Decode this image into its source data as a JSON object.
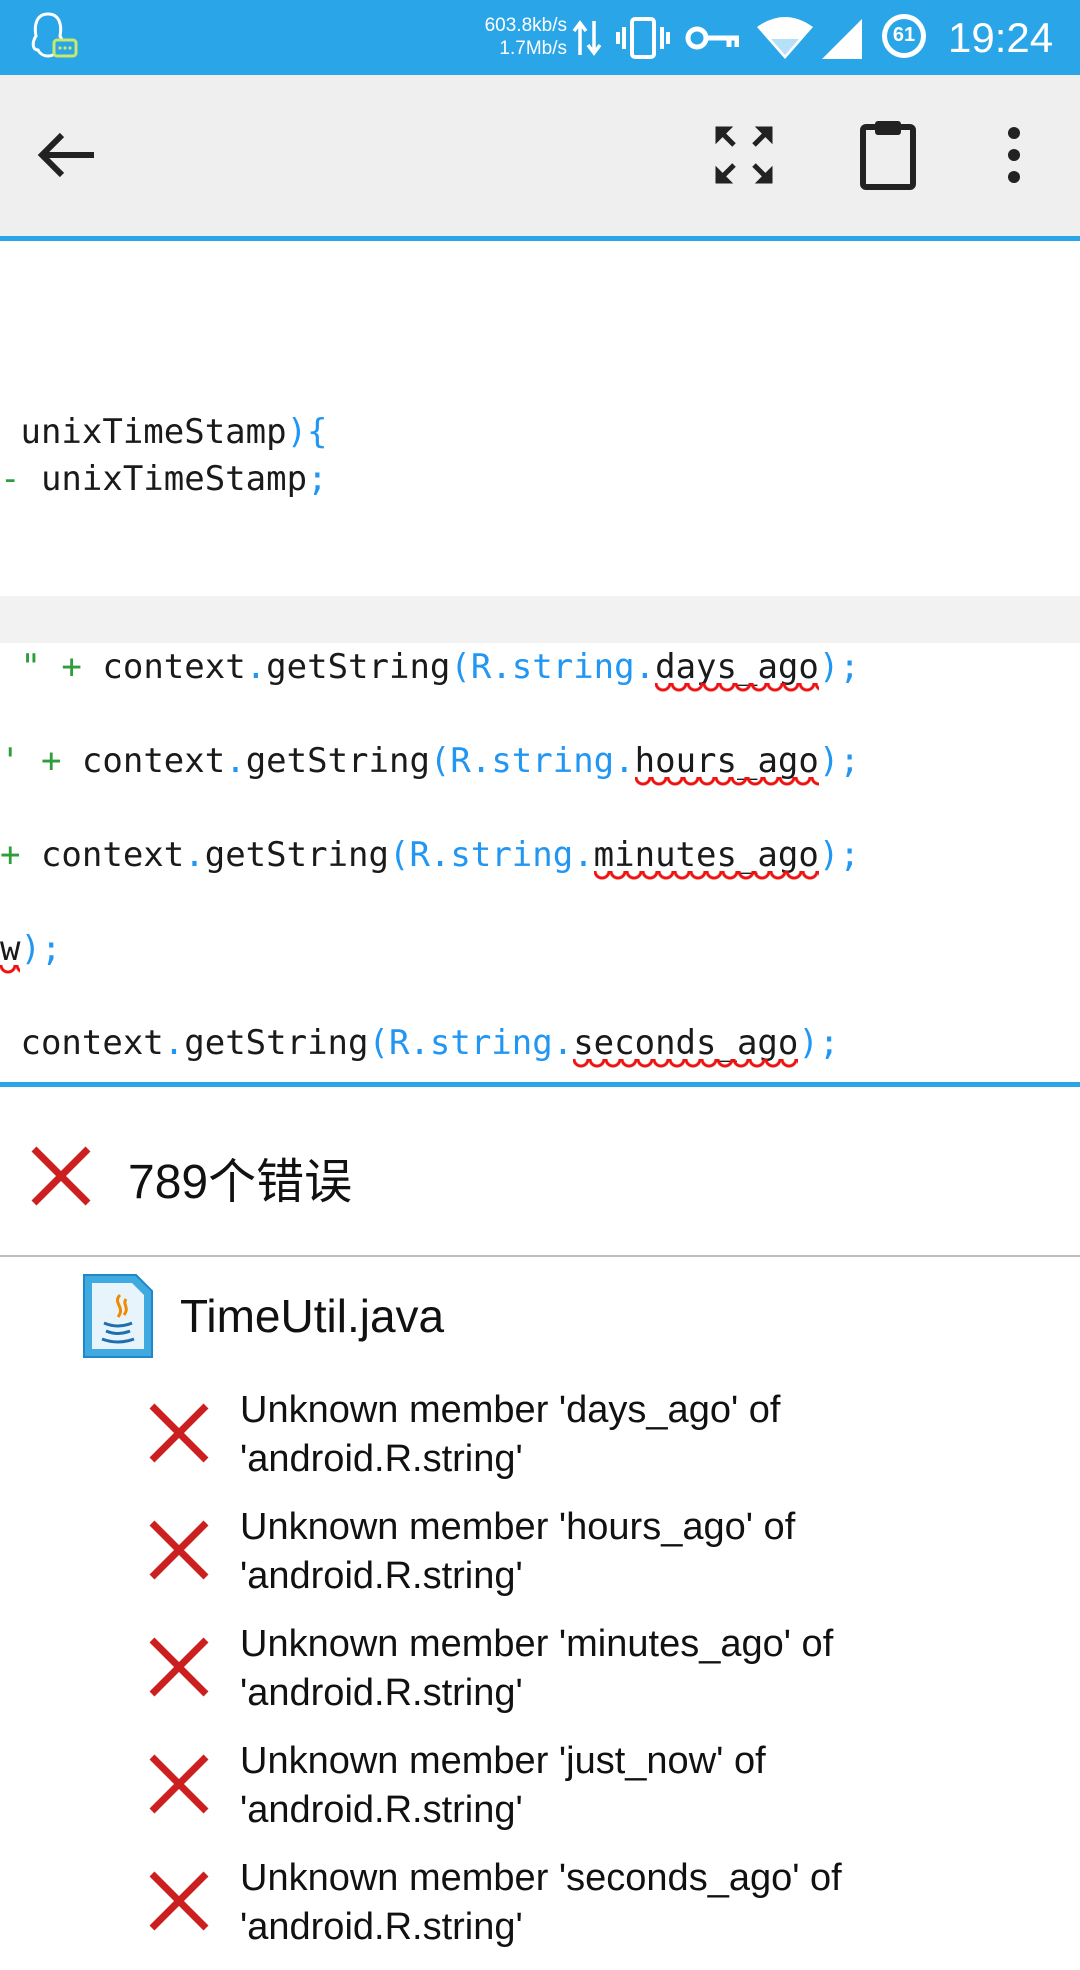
{
  "status_bar": {
    "speed_up": "603.8kb/s",
    "speed_down": "1.7Mb/s",
    "battery_level": "61",
    "time": "19:24",
    "icons": [
      "qq-notification-icon",
      "data-transfer-icon",
      "vibrate-icon",
      "vpn-key-icon",
      "wifi-icon",
      "cell-signal-icon",
      "battery-icon"
    ]
  },
  "toolbar": {
    "icons": [
      "back-arrow-icon",
      "fullscreen-icon",
      "clipboard-icon",
      "more-vert-icon"
    ]
  },
  "code": {
    "lines": [
      {
        "tokens": [
          {
            "t": " unixTimeStamp",
            "c": ""
          },
          {
            "t": "){",
            "c": "p"
          }
        ]
      },
      {
        "tokens": [
          {
            "t": "-",
            "c": "g"
          },
          {
            "t": " unixTimeStamp",
            "c": ""
          },
          {
            "t": ";",
            "c": "p"
          }
        ]
      },
      {
        "tokens": [
          {
            "t": " \"",
            "c": "s"
          },
          {
            "t": " + ",
            "c": "g"
          },
          {
            "t": "context",
            "c": ""
          },
          {
            "t": ".",
            "c": "p"
          },
          {
            "t": "getString",
            "c": ""
          },
          {
            "t": "(R.string.",
            "c": "p"
          },
          {
            "t": "days_ago",
            "c": "e"
          },
          {
            "t": ");",
            "c": "p"
          }
        ]
      },
      {
        "tokens": [
          {
            "t": "'",
            "c": "s"
          },
          {
            "t": " + ",
            "c": "g"
          },
          {
            "t": "context",
            "c": ""
          },
          {
            "t": ".",
            "c": "p"
          },
          {
            "t": "getString",
            "c": ""
          },
          {
            "t": "(R.string.",
            "c": "p"
          },
          {
            "t": "hours_ago",
            "c": "e"
          },
          {
            "t": ");",
            "c": "p"
          }
        ]
      },
      {
        "tokens": [
          {
            "t": "+",
            "c": "g"
          },
          {
            "t": " context",
            "c": ""
          },
          {
            "t": ".",
            "c": "p"
          },
          {
            "t": "getString",
            "c": ""
          },
          {
            "t": "(R.string.",
            "c": "p"
          },
          {
            "t": "minutes_ago",
            "c": "e"
          },
          {
            "t": ");",
            "c": "p"
          }
        ]
      },
      {
        "tokens": [
          {
            "t": "w",
            "c": "e"
          },
          {
            "t": ");",
            "c": "p"
          }
        ]
      },
      {
        "tokens": [
          {
            "t": " context",
            "c": ""
          },
          {
            "t": ".",
            "c": "p"
          },
          {
            "t": "getString",
            "c": ""
          },
          {
            "t": "(R.string.",
            "c": "p"
          },
          {
            "t": "seconds_ago",
            "c": "e"
          },
          {
            "t": ");",
            "c": "p"
          }
        ]
      }
    ]
  },
  "errors": {
    "count_label": "789个错误",
    "file": "TimeUtil.java",
    "items": [
      {
        "line1": "Unknown member 'days_ago' of",
        "line2": "'android.R.string'"
      },
      {
        "line1": "Unknown member 'hours_ago' of",
        "line2": "'android.R.string'"
      },
      {
        "line1": "Unknown member 'minutes_ago' of",
        "line2": "'android.R.string'"
      },
      {
        "line1": "Unknown member 'just_now' of",
        "line2": "'android.R.string'"
      },
      {
        "line1": "Unknown member 'seconds_ago' of",
        "line2": "'android.R.string'"
      }
    ]
  },
  "colors": {
    "accent": "#2aa6e8",
    "error": "#cc1f1f",
    "punct": "#2196f3",
    "operator": "#2e9d3b"
  }
}
